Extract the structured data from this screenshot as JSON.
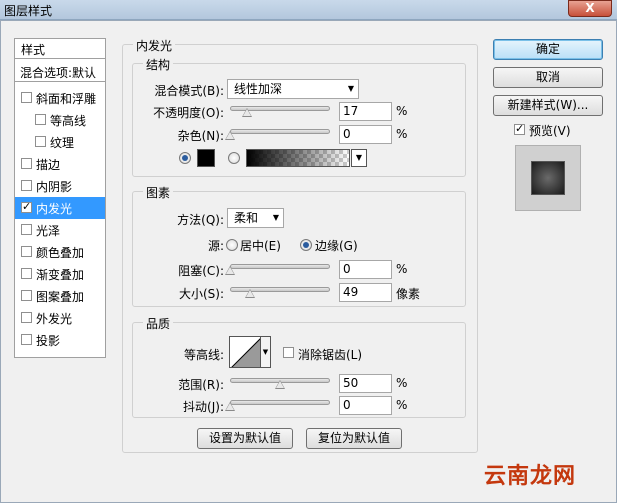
{
  "window": {
    "title": "图层样式",
    "close_label": "X"
  },
  "left_panel": {
    "header": "样式",
    "blend_options": "混合选项:默认",
    "items": [
      {
        "label": "斜面和浮雕",
        "checked": false,
        "indent": false,
        "selected": false
      },
      {
        "label": "等高线",
        "checked": false,
        "indent": true,
        "selected": false
      },
      {
        "label": "纹理",
        "checked": false,
        "indent": true,
        "selected": false
      },
      {
        "label": "描边",
        "checked": false,
        "indent": false,
        "selected": false
      },
      {
        "label": "内阴影",
        "checked": false,
        "indent": false,
        "selected": false
      },
      {
        "label": "内发光",
        "checked": true,
        "indent": false,
        "selected": true
      },
      {
        "label": "光泽",
        "checked": false,
        "indent": false,
        "selected": false
      },
      {
        "label": "颜色叠加",
        "checked": false,
        "indent": false,
        "selected": false
      },
      {
        "label": "渐变叠加",
        "checked": false,
        "indent": false,
        "selected": false
      },
      {
        "label": "图案叠加",
        "checked": false,
        "indent": false,
        "selected": false
      },
      {
        "label": "外发光",
        "checked": false,
        "indent": false,
        "selected": false
      },
      {
        "label": "投影",
        "checked": false,
        "indent": false,
        "selected": false
      }
    ]
  },
  "inner_glow": {
    "title": "内发光",
    "structure": {
      "title": "结构",
      "blend_mode_label": "混合模式(B):",
      "blend_mode_value": "线性加深",
      "opacity_label": "不透明度(O):",
      "opacity_value": "17",
      "opacity_fraction": 0.17,
      "noise_label": "杂色(N):",
      "noise_value": "0",
      "noise_fraction": 0,
      "percent": "%",
      "solid_color": "#000000"
    },
    "elements": {
      "title": "图素",
      "method_label": "方法(Q):",
      "method_value": "柔和",
      "source_label": "源:",
      "center_label": "居中(E)",
      "edge_label": "边缘(G)",
      "choke_label": "阻塞(C):",
      "choke_value": "0",
      "choke_fraction": 0,
      "size_label": "大小(S):",
      "size_value": "49",
      "size_fraction": 0.2,
      "size_unit": "像素",
      "percent": "%"
    },
    "quality": {
      "title": "品质",
      "contour_label": "等高线:",
      "anti_alias_label": "消除锯齿(L)",
      "range_label": "范围(R):",
      "range_value": "50",
      "range_fraction": 0.5,
      "jitter_label": "抖动(J):",
      "jitter_value": "0",
      "jitter_fraction": 0,
      "percent": "%"
    },
    "make_default": "设置为默认值",
    "reset_default": "复位为默认值"
  },
  "buttons": {
    "ok": "确定",
    "cancel": "取消",
    "new_style": "新建样式(W)...",
    "preview_label": "预览(V)",
    "preview_checked": true
  },
  "watermark": "云南龙网"
}
